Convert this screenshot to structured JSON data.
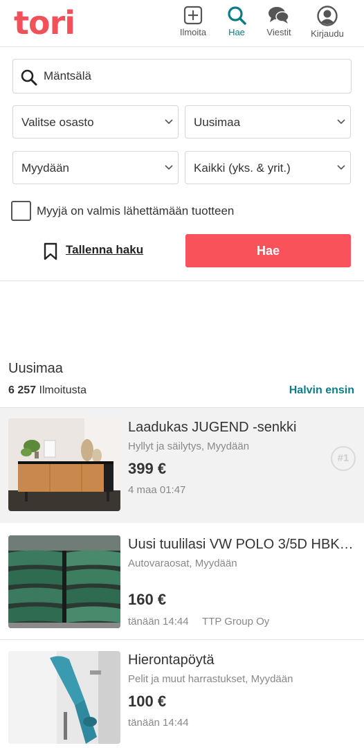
{
  "header": {
    "logo": "tori",
    "nav": [
      {
        "label": "Ilmoita",
        "icon": "plus-square-icon"
      },
      {
        "label": "Hae",
        "icon": "search-icon",
        "active": true
      },
      {
        "label": "Viestit",
        "icon": "chat-bubbles-icon"
      },
      {
        "label": "Kirjaudu",
        "icon": "user-circle-icon"
      }
    ]
  },
  "search": {
    "value": "Mäntsälä",
    "category_select": "Valitse osasto",
    "region_select": "Uusimaa",
    "type_select": "Myydään",
    "seller_select": "Kaikki (yks. & yrit.)",
    "shipping_checkbox_label": "Myyjä on valmis lähettämään tuotteen",
    "shipping_checked": false,
    "save_search_label": "Tallenna haku",
    "search_button_label": "Hae"
  },
  "results": {
    "region": "Uusimaa",
    "count": "6 257",
    "count_suffix": "Ilmoitusta",
    "sort_label": "Halvin ensin"
  },
  "listings": [
    {
      "title": "Laadukas JUGEND -senkki",
      "category": "Hyllyt ja säilytys, Myydään",
      "price": "399 €",
      "date": "4 maa 01:47",
      "badge": "#1",
      "highlighted": true
    },
    {
      "title": "Uusi tuulilasi VW POLO 3/5D HBK v...",
      "category": "Autovaraosat, Myydään",
      "price": "160 €",
      "date": "tänään 14:44",
      "seller": "TTP Group Oy"
    },
    {
      "title": "Hierontapöytä",
      "category": "Pelit ja muut harrastukset, Myydään",
      "price": "100 €",
      "date": "tänään 14:44"
    }
  ],
  "colors": {
    "brand": "#f1525a",
    "accent": "#0e7c86",
    "button": "#f9525b"
  }
}
